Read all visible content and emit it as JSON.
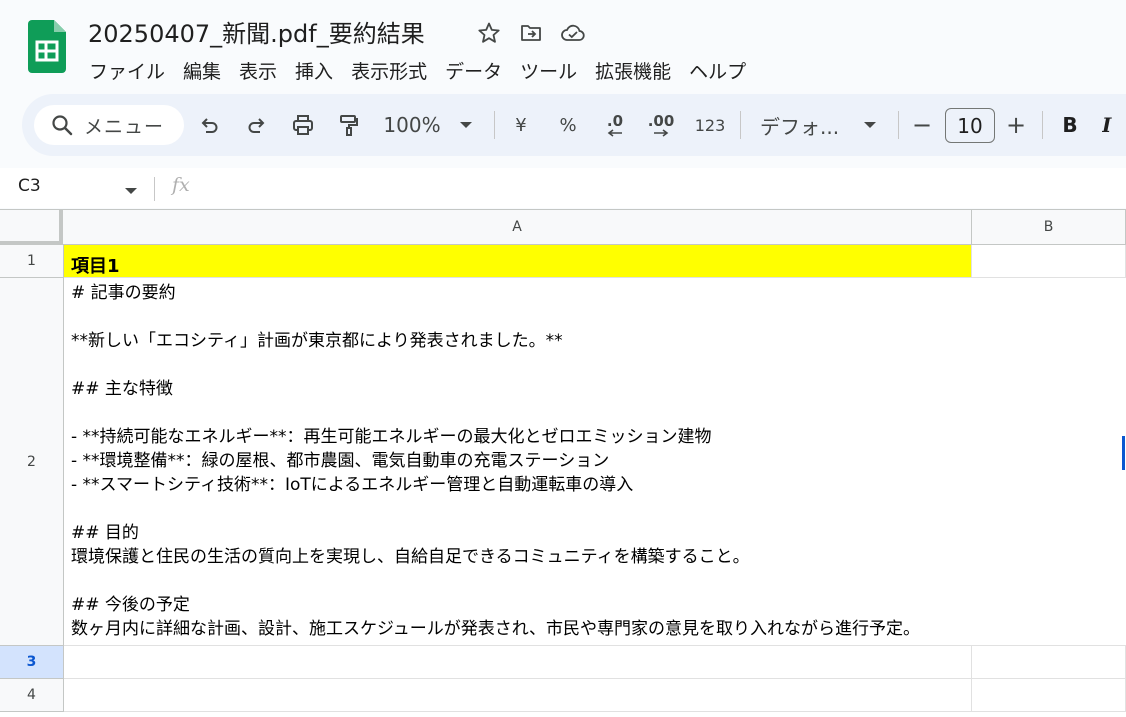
{
  "app": {
    "name": "Google Sheets",
    "brand_color": "#0f9d58"
  },
  "document": {
    "title": "20250407_新聞.pdf_要約結果"
  },
  "title_icons": [
    "star-icon",
    "move-to-folder-icon",
    "cloud-saved-icon"
  ],
  "menu": [
    "ファイル",
    "編集",
    "表示",
    "挿入",
    "表示形式",
    "データ",
    "ツール",
    "拡張機能",
    "ヘルプ"
  ],
  "toolbar": {
    "search_label": "メニュー",
    "zoom": "100%",
    "currency": "¥",
    "percent": "%",
    "decrease_decimal": ".0",
    "increase_decimal": ".00",
    "number_format": "123",
    "font": "デフォ...",
    "font_size": "10",
    "minus": "−",
    "plus": "+",
    "bold": "B",
    "italic": "I"
  },
  "formula_bar": {
    "cell_ref": "C3",
    "fx": "fx",
    "content": ""
  },
  "columns": [
    "A",
    "B"
  ],
  "rows": [
    "1",
    "2",
    "3",
    "4"
  ],
  "selected_row": "3",
  "cells": {
    "A1": "項目1",
    "A2": "# 記事の要約\n\n**新しい「エコシティ」計画が東京都により発表されました。**\n\n## 主な特徴\n\n- **持続可能なエネルギー**：再生可能エネルギーの最大化とゼロエミッション建物\n- **環境整備**：緑の屋根、都市農園、電気自動車の充電ステーション\n- **スマートシティ技術**：IoTによるエネルギー管理と自動運転車の導入\n\n## 目的\n環境保護と住民の生活の質向上を実現し、自給自足できるコミュニティを構築すること。\n\n## 今後の予定\n数ヶ月内に詳細な計画、設計、施工スケジュールが発表され、市民や専門家の意見を取り入れながら進行予定。"
  },
  "colors": {
    "header_fill": "#ffff00",
    "selection": "#0b57d0",
    "toolbar_bg": "#edf2fa"
  }
}
